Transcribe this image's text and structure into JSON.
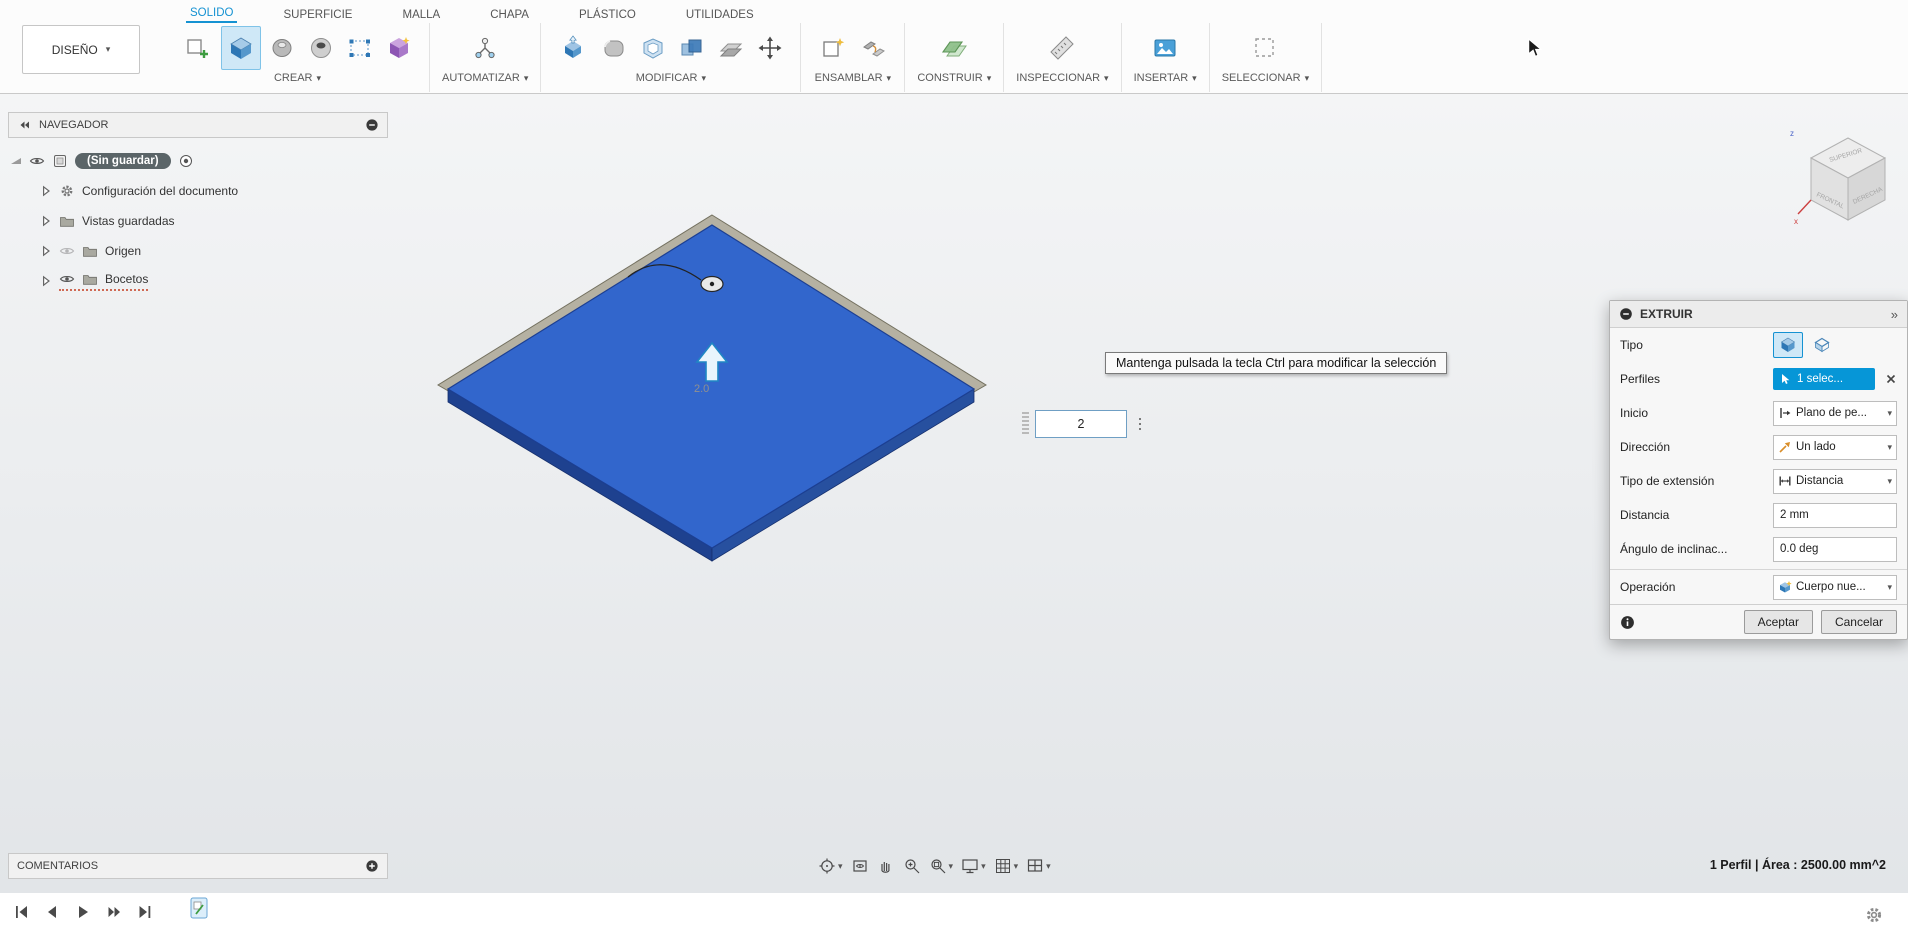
{
  "app": {
    "design_menu": "DISEÑO",
    "tabs": [
      {
        "label": "SOLIDO",
        "active": true
      },
      {
        "label": "SUPERFICIE"
      },
      {
        "label": "MALLA"
      },
      {
        "label": "CHAPA"
      },
      {
        "label": "PLÁSTICO"
      },
      {
        "label": "UTILIDADES"
      }
    ],
    "groups": [
      {
        "label": "CREAR"
      },
      {
        "label": "AUTOMATIZAR"
      },
      {
        "label": "MODIFICAR"
      },
      {
        "label": "ENSAMBLAR"
      },
      {
        "label": "CONSTRUIR"
      },
      {
        "label": "INSPECCIONAR"
      },
      {
        "label": "INSERTAR"
      },
      {
        "label": "SELECCIONAR"
      }
    ]
  },
  "navigator": {
    "title": "NAVEGADOR",
    "root_label": "(Sin guardar)",
    "items": [
      {
        "label": "Configuración del documento"
      },
      {
        "label": "Vistas guardadas"
      },
      {
        "label": "Origen"
      },
      {
        "label": "Bocetos"
      }
    ]
  },
  "canvas": {
    "tooltip": "Mantenga pulsada la tecla Ctrl para modificar la selección",
    "distance_input": "2",
    "distance_label": "2.0"
  },
  "viewcube": {
    "faces": [
      "SUPERIOR",
      "FRONTAL",
      "DERECHA"
    ],
    "axis_x": "x",
    "axis_z": "z"
  },
  "dialog": {
    "title": "EXTRUIR",
    "fields": {
      "tipo_label": "Tipo",
      "perfiles_label": "Perfiles",
      "perfiles_value": "1 selec...",
      "inicio_label": "Inicio",
      "inicio_value": "Plano de pe...",
      "direccion_label": "Dirección",
      "direccion_value": "Un lado",
      "extension_label": "Tipo de extensión",
      "extension_value": "Distancia",
      "distancia_label": "Distancia",
      "distancia_value": "2 mm",
      "angulo_label": "Ángulo de inclinac...",
      "angulo_value": "0.0 deg",
      "operacion_label": "Operación",
      "operacion_value": "Cuerpo nue..."
    },
    "buttons": {
      "accept": "Aceptar",
      "cancel": "Cancelar"
    }
  },
  "bottom": {
    "comments_title": "COMENTARIOS",
    "status": "1 Perfil | Área : 2500.00 mm^2"
  },
  "icons": {
    "caret": "▾",
    "chevrons_right": "»"
  },
  "colors": {
    "accent": "#0696d7",
    "body_selection": "#3266cc"
  }
}
